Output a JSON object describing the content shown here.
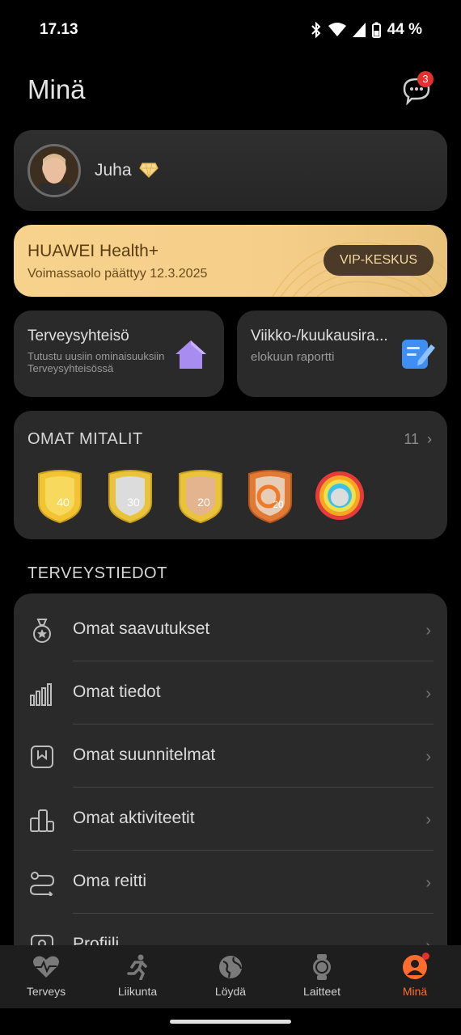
{
  "status": {
    "time": "17.13",
    "battery": "44 %"
  },
  "header": {
    "title": "Minä",
    "message_badge": "3"
  },
  "profile": {
    "name": "Juha"
  },
  "vip": {
    "title": "HUAWEI Health+",
    "subtitle": "Voimassaolo päättyy 12.3.2025",
    "button": "VIP-KESKUS"
  },
  "cards": {
    "community": {
      "title": "Terveysyhteisö",
      "subtitle": "Tutustu uusiin ominaisuuksiin Terveysyhteisössä"
    },
    "reports": {
      "title": "Viikko-/kuukausira...",
      "subtitle": "elokuun raportti"
    }
  },
  "medals": {
    "title": "OMAT MITALIT",
    "count": "11",
    "items": [
      "40",
      "30",
      "20",
      "20",
      ""
    ]
  },
  "health": {
    "title": "TERVEYSTIEDOT",
    "items": [
      {
        "label": "Omat saavutukset",
        "icon": "medal-icon"
      },
      {
        "label": "Omat tiedot",
        "icon": "bar-chart-icon"
      },
      {
        "label": "Omat suunnitelmat",
        "icon": "bookmark-icon"
      },
      {
        "label": "Omat aktiviteetit",
        "icon": "activities-icon"
      },
      {
        "label": "Oma reitti",
        "icon": "route-icon"
      },
      {
        "label": "Profiili",
        "icon": "profile-icon"
      }
    ]
  },
  "tabs": [
    {
      "label": "Terveys",
      "icon": "heart-icon"
    },
    {
      "label": "Liikunta",
      "icon": "runner-icon"
    },
    {
      "label": "Löydä",
      "icon": "globe-icon"
    },
    {
      "label": "Laitteet",
      "icon": "watch-icon"
    },
    {
      "label": "Minä",
      "icon": "person-icon"
    }
  ],
  "colors": {
    "accent": "#ff6d2e",
    "vip_gold": "#f5cf8a",
    "card_bg": "#2a2a2a"
  }
}
